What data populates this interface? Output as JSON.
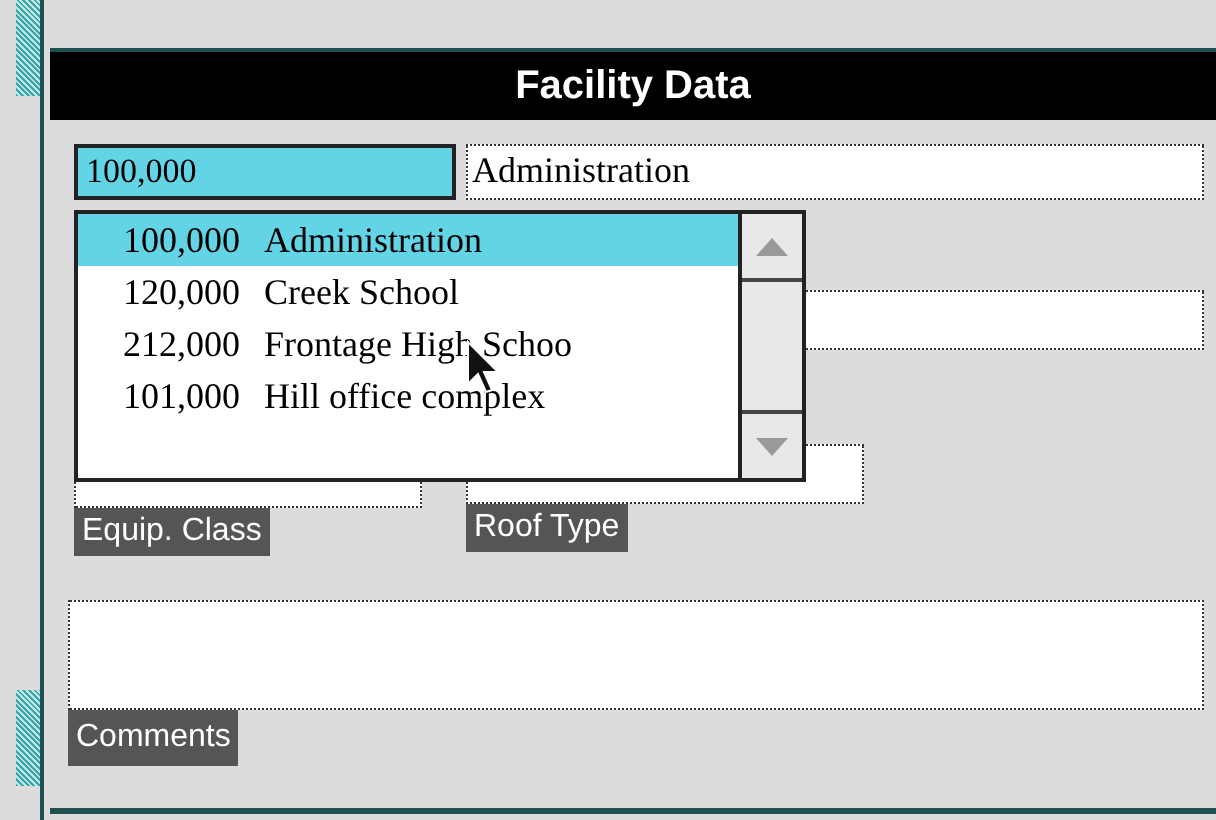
{
  "title": "Facility Data",
  "facility": {
    "code": "100,000",
    "name": "Administration"
  },
  "dropdown": {
    "items": [
      {
        "code": "100,000",
        "name": "Administration",
        "selected": true
      },
      {
        "code": "120,000",
        "name": "Creek School",
        "selected": false
      },
      {
        "code": "212,000",
        "name": "Frontage High Schoo",
        "selected": false
      },
      {
        "code": "101,000",
        "name": "Hill office complex",
        "selected": false
      }
    ]
  },
  "labels": {
    "equip_class": "Equip. Class",
    "roof_type": "Roof Type",
    "comments": "Comments"
  }
}
